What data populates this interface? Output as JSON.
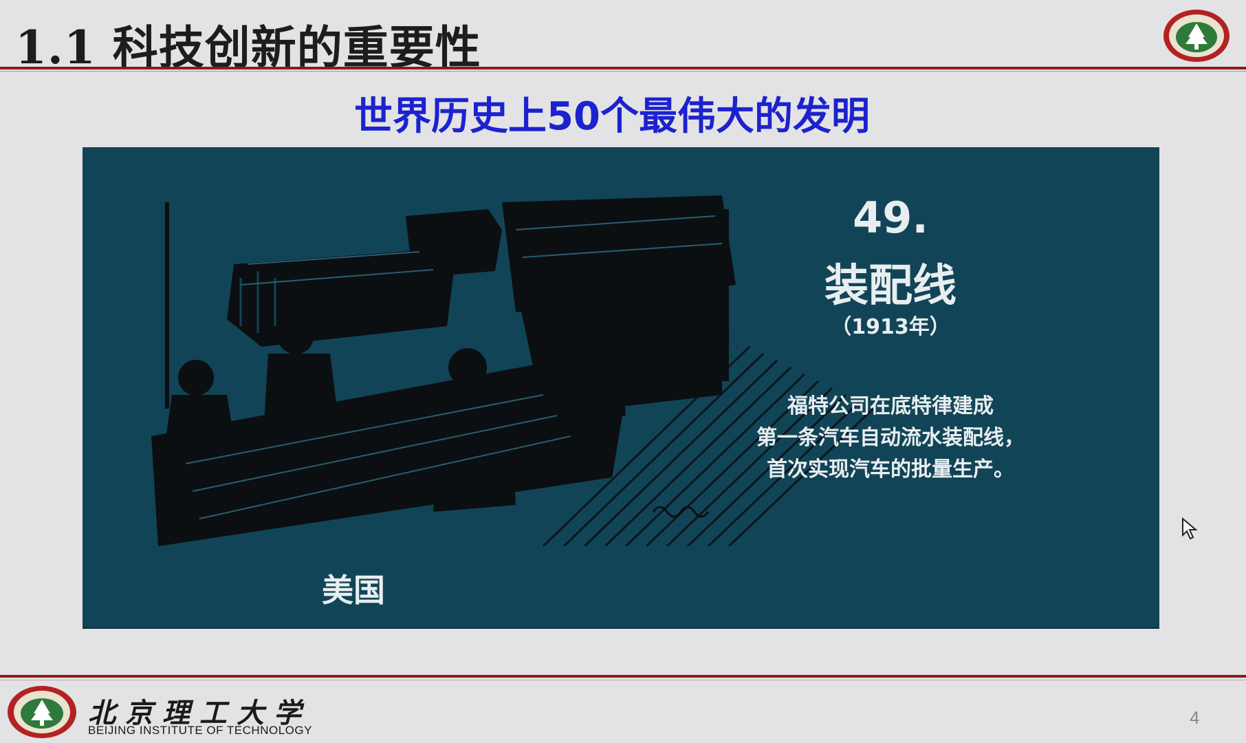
{
  "slide": {
    "title": "1.1 科技创新的重要性",
    "subtitle": "世界历史上50个最伟大的发明",
    "page_number": "4"
  },
  "invention": {
    "number": "49.",
    "name": "装配线",
    "year": "（1913年）",
    "description_lines": [
      "福特公司在底特律建成",
      "第一条汽车自动流水装配线，",
      "首次实现汽车的批量生产。"
    ],
    "country": "美国"
  },
  "footer": {
    "university_cn": "北京理工大学",
    "university_en": "BEIJING INSTITUTE OF TECHNOLOGY"
  },
  "colors": {
    "title_rule": "#8b1c1c",
    "subtitle": "#1d22cf",
    "panel_bg": "#124457",
    "panel_text": "#e8eef0"
  },
  "icons": {
    "logo": "university-emblem-icon",
    "cursor": "mouse-pointer-icon"
  }
}
